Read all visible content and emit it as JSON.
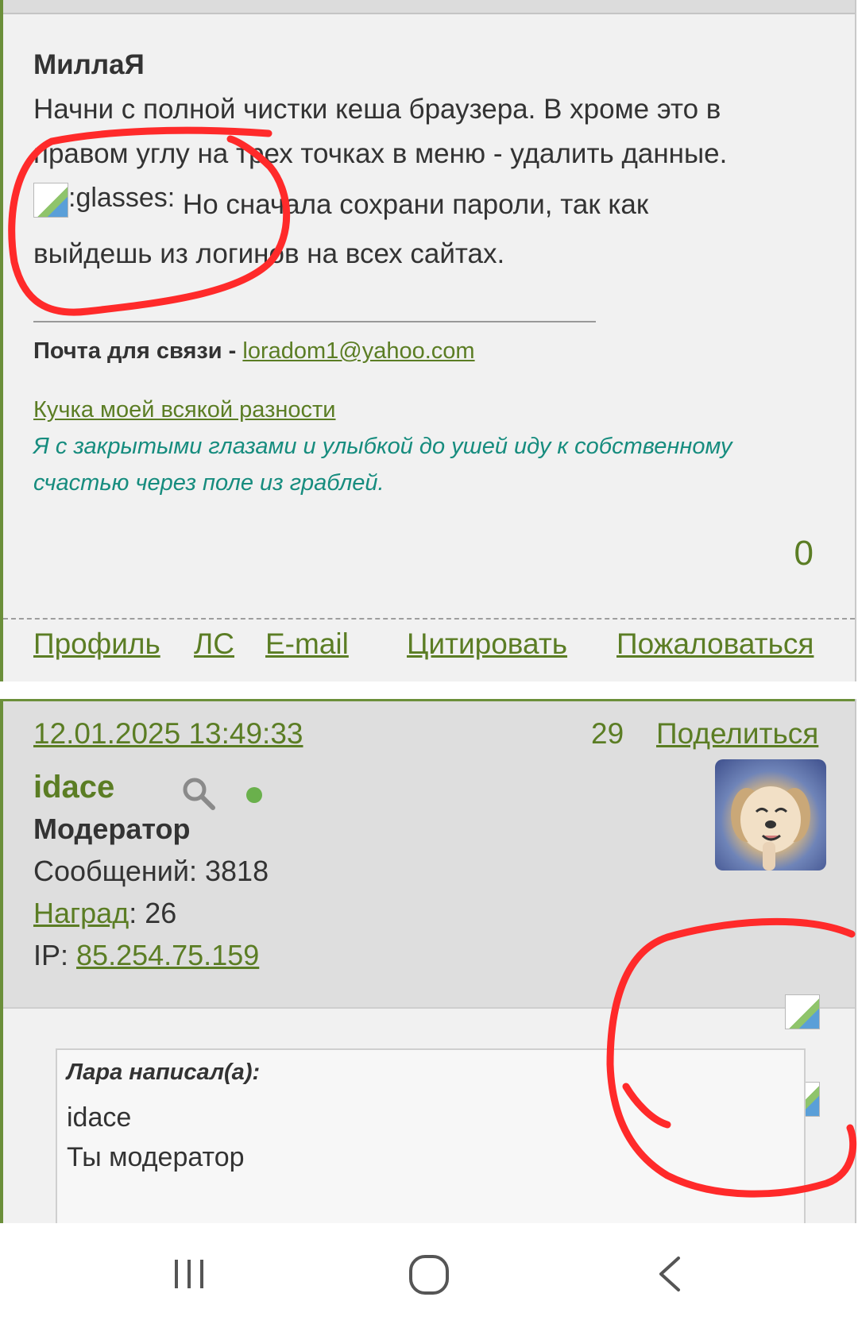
{
  "post1": {
    "author": "МиллаЯ",
    "lines": [
      "Начни с полной чистки кеша браузера.  В хроме это в",
      "правом углу на трех точках в меню - удалить данные."
    ],
    "smiley_alt": ":glasses:",
    "line3_rest": " Но сначала сохрани пароли, так как",
    "line4": "выйдешь из логинов на всех сайтах.",
    "signature": {
      "mail_label": "Почта для связи - ",
      "mail_link": "loradom1@yahoo.com",
      "link_text": "Кучка моей всякой разности",
      "quote_lines": [
        "Я с закрытыми глазами и улыбкой до ушей иду к собственному",
        "счастью через поле из граблей."
      ]
    },
    "vote_count": "0",
    "actions": [
      "Профиль",
      "ЛС",
      "E-mail",
      "Цитировать",
      "Пожаловаться"
    ]
  },
  "post2": {
    "date": "12.01.2025 13:49:33",
    "number": "29",
    "share": "Поделиться",
    "username": "idace",
    "status": "Модератор",
    "messages_label": "Сообщений: 3818",
    "awards_link": "Наград",
    "awards_value": ": 26",
    "ip_label": "IP: ",
    "ip_value": "85.254.75.159",
    "quote": {
      "author": "Лара написал(а):",
      "lines": [
        "idace",
        "Ты модератор"
      ]
    }
  },
  "colors": {
    "accent_green": "#5b7d24",
    "quote_teal": "#168c7e",
    "annotation_red": "#ff2a2a",
    "online_dot": "#6ab04c"
  },
  "icons": [
    "search-icon",
    "online-dot-icon",
    "broken-image-icon",
    "recents-icon",
    "home-icon",
    "back-icon"
  ]
}
